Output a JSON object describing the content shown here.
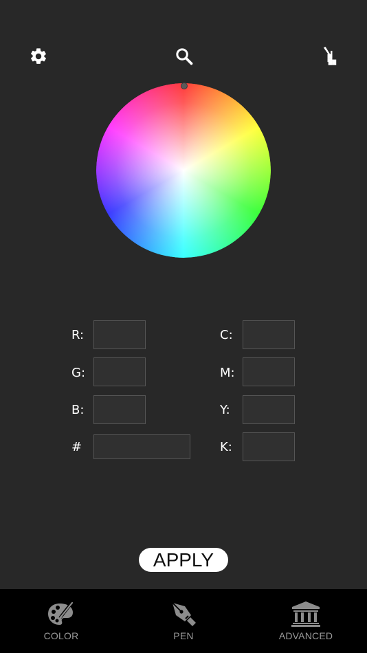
{
  "toolbar": {
    "settings_icon": "gear-icon",
    "search_icon": "search-icon",
    "brush_icon": "brush-icon"
  },
  "color_wheel": {
    "icon": "color-wheel"
  },
  "fields": {
    "r": {
      "label": "R:",
      "value": ""
    },
    "g": {
      "label": "G:",
      "value": ""
    },
    "b": {
      "label": "B:",
      "value": ""
    },
    "hex": {
      "label": "#",
      "value": ""
    },
    "c": {
      "label": "C:",
      "value": ""
    },
    "m": {
      "label": "M:",
      "value": ""
    },
    "y": {
      "label": "Y:",
      "value": ""
    },
    "k": {
      "label": "K:",
      "value": ""
    }
  },
  "apply_label": "APPLY",
  "tabs": [
    {
      "label": "COLOR",
      "icon": "palette-icon"
    },
    {
      "label": "PEN",
      "icon": "pen-nib-icon"
    },
    {
      "label": "ADVANCED",
      "icon": "building-icon"
    }
  ],
  "colors": {
    "background": "#282828",
    "tabbar": "#000000",
    "input_bg": "#303030",
    "input_border": "#555555",
    "tab_label": "#9a9a9a",
    "apply_bg": "#ffffff"
  }
}
